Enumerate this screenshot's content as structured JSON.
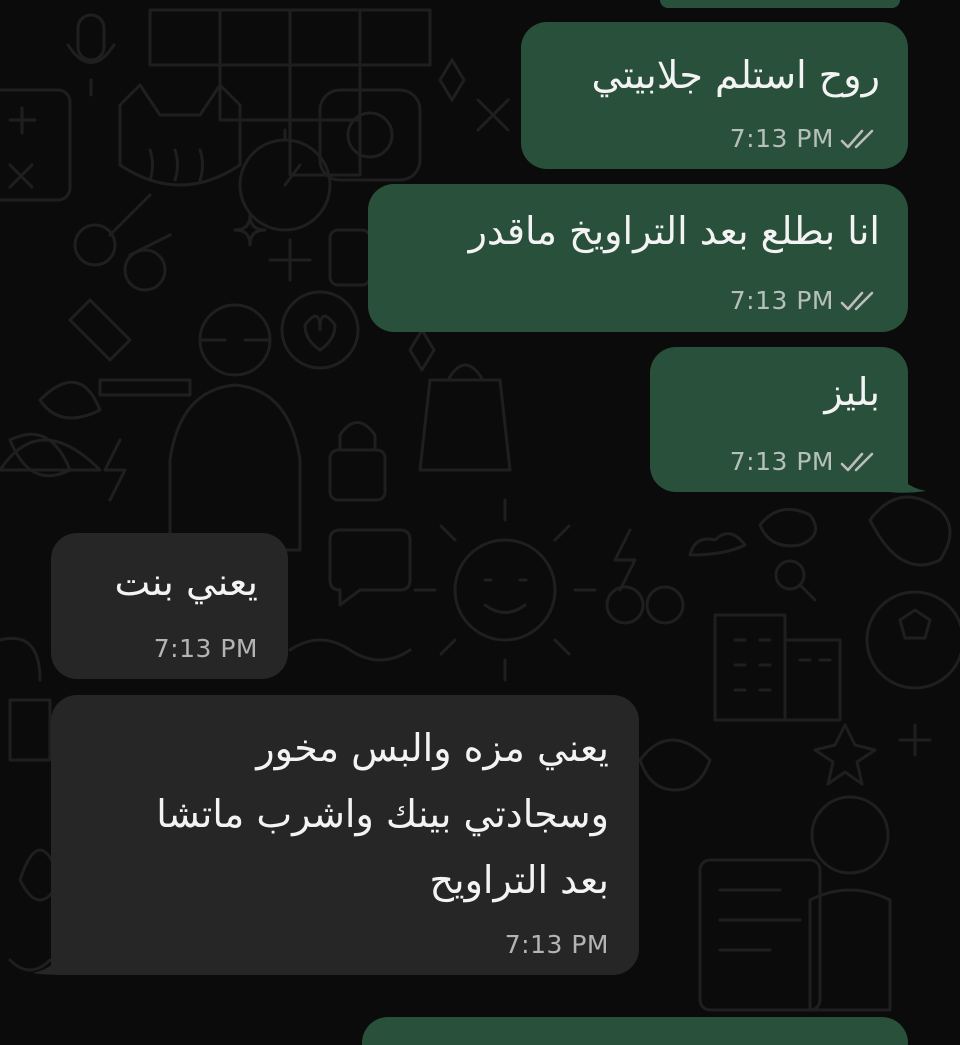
{
  "chat": {
    "colors": {
      "background": "#0b0b0b",
      "outgoing_bubble": "#29503a",
      "incoming_bubble": "#262626",
      "text": "#f3f3f3",
      "meta": "#bdbdbd"
    },
    "messages": [
      {
        "direction": "out",
        "text": "روح استلم جلابيتي",
        "time": "7:13 PM",
        "status": "read-double-check-icon"
      },
      {
        "direction": "out",
        "text": "انا بطلع بعد التراويخ ماقدر",
        "time": "7:13 PM",
        "status": "read-double-check-icon"
      },
      {
        "direction": "out",
        "text": "بليز",
        "time": "7:13 PM",
        "status": "read-double-check-icon"
      },
      {
        "direction": "in",
        "text": "يعني بنت",
        "time": "7:13 PM"
      },
      {
        "direction": "in",
        "lines": [
          "يعني مزه والبس مخور",
          "وسجادتي بينك واشرب ماتشا",
          "بعد التراويح"
        ],
        "time": "7:13 PM"
      }
    ]
  }
}
